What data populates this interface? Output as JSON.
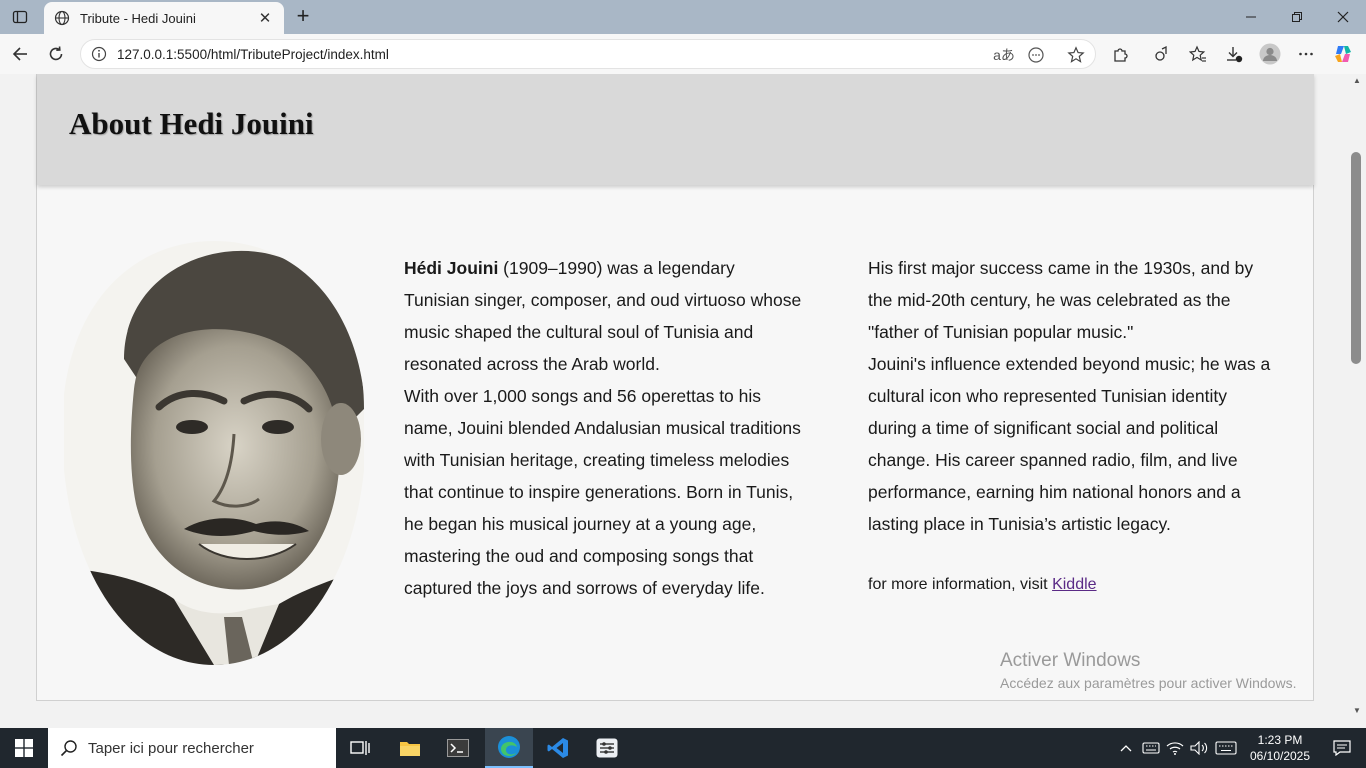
{
  "browser": {
    "tab_title": "Tribute - Hedi Jouini",
    "url": "127.0.0.1:5500/html/TributeProject/index.html"
  },
  "page": {
    "heading": "About Hedi Jouini",
    "left_column": {
      "intro_bold": "Hédi Jouini",
      "intro_rest": " (1909–1990) was a legendary Tunisian singer, composer, and oud virtuoso whose music shaped the cultural soul of Tunisia and resonated across the Arab world.",
      "paragraph_2": "With over 1,000 songs and 56 operettas to his name, Jouini blended Andalusian musical traditions with Tunisian heritage, creating timeless melodies that continue to inspire generations. Born in Tunis, he began his musical journey at a young age, mastering the oud and composing songs that captured the joys and sorrows of everyday life."
    },
    "right_column": {
      "paragraph_1": "His first major success came in the 1930s, and by the mid-20th century, he was celebrated as the \"father of Tunisian popular music.\"",
      "paragraph_2": "Jouini's influence extended beyond music; he was a cultural icon who represented Tunisian identity during a time of significant social and political change. His career spanned radio, film, and live performance, earning him national honors and a lasting place in Tunisia’s artistic legacy."
    },
    "more_info": {
      "prefix": "for more information, visit ",
      "link_label": "Kiddle"
    }
  },
  "watermark": {
    "line1": "Activer Windows",
    "line2": "Accédez aux paramètres pour activer Windows."
  },
  "taskbar": {
    "search_placeholder": "Taper ici pour rechercher",
    "time": "1:23 PM",
    "date": "06/10/2025"
  },
  "colors": {
    "header_bg": "#d9d9d9",
    "link": "#5a2a86",
    "taskbar": "#20272e"
  }
}
